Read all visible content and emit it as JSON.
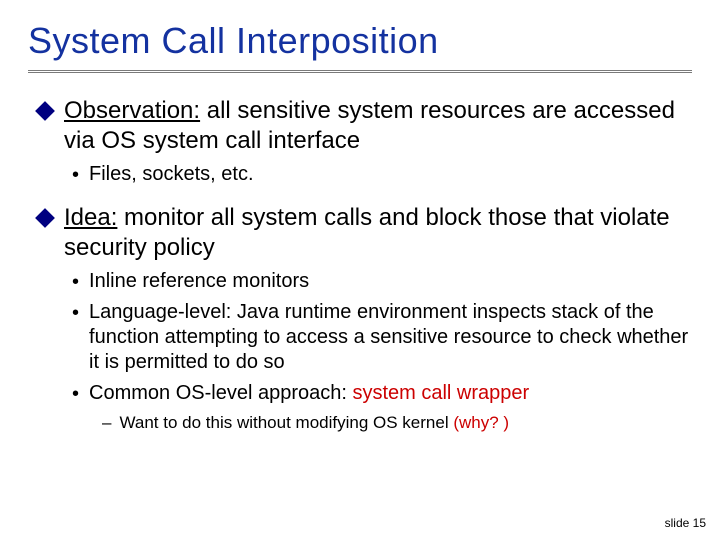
{
  "title": "System Call Interposition",
  "bullet1": {
    "lead": "Observation:",
    "rest": " all sensitive system resources are accessed via OS system call interface"
  },
  "sub1a": "Files, sockets, etc.",
  "bullet2": {
    "lead": "Idea:",
    "rest": " monitor all system calls and block those that violate security policy"
  },
  "sub2a": "Inline reference monitors",
  "sub2b": "Language-level: Java runtime environment inspects stack of the function attempting to access a sensitive resource to check whether it is permitted to do so",
  "sub2c_pre": "Common OS-level approach: ",
  "sub2c_red": "system call wrapper",
  "sub2c_sub_pre": "Want to do this without modifying OS kernel ",
  "sub2c_sub_red": "(why? )",
  "footer": "slide 15"
}
